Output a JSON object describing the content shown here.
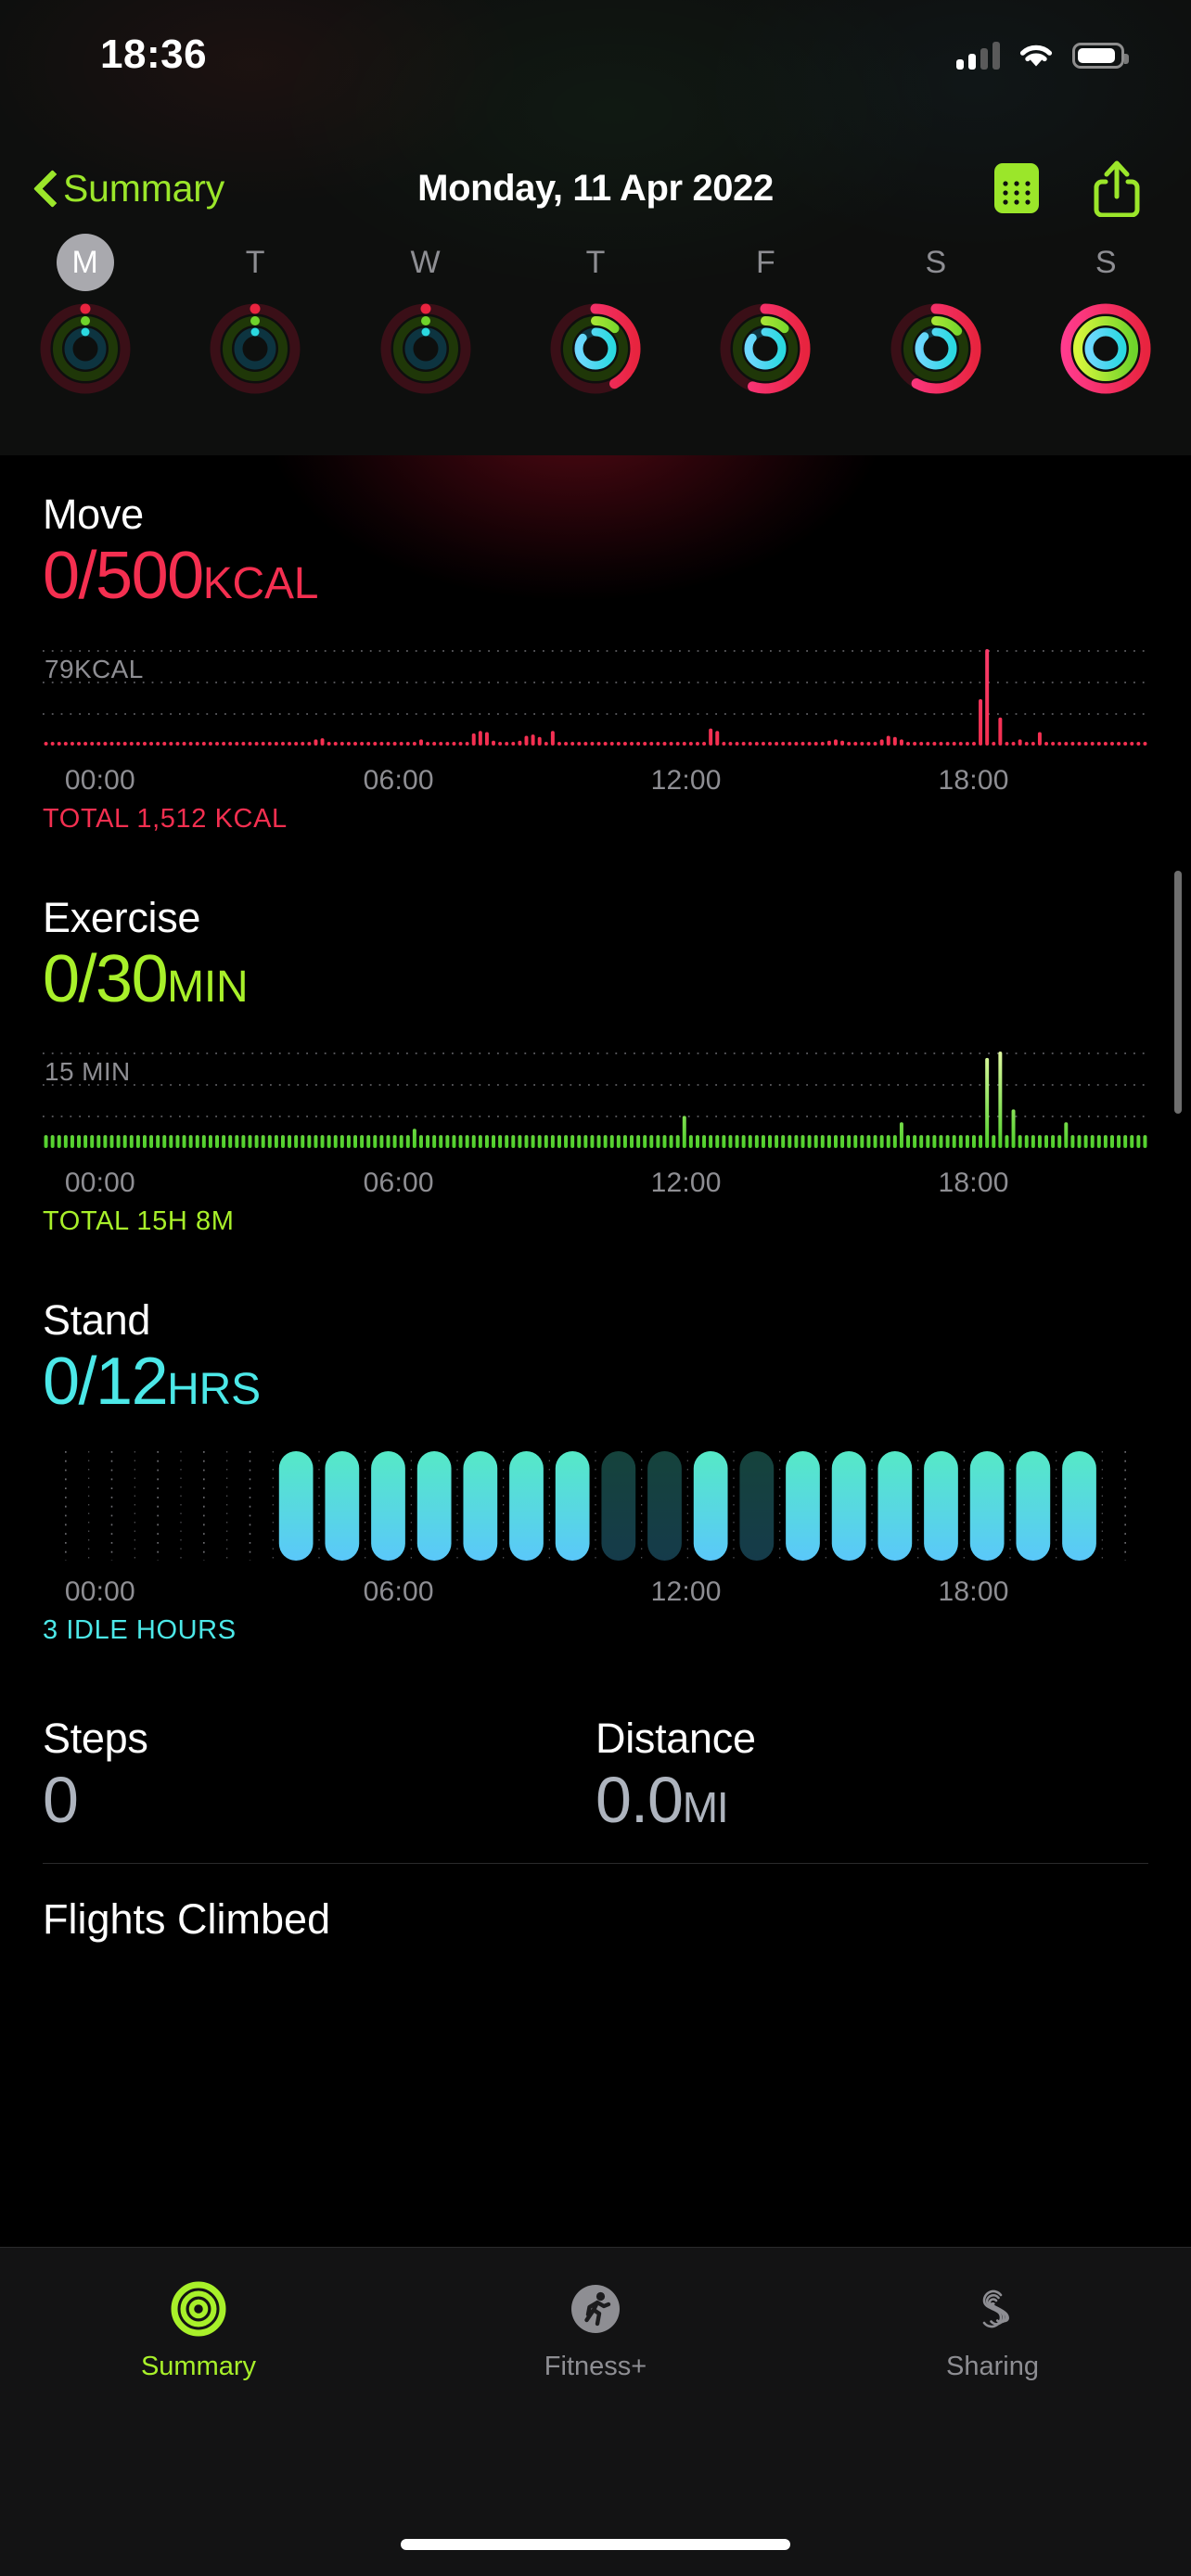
{
  "status_bar": {
    "time": "18:36",
    "cellular_icon": "cellular-signal-icon",
    "cellular_bars_filled": 2,
    "wifi_icon": "wifi-icon",
    "battery_icon": "battery-icon",
    "battery_level_pct": 78
  },
  "nav": {
    "back_label": "Summary",
    "back_icon": "chevron-left-icon",
    "title": "Monday, 11 Apr 2022",
    "calendar_icon": "calendar-icon",
    "share_icon": "share-icon"
  },
  "week": {
    "days": [
      {
        "label": "M",
        "selected": true,
        "move_pct": 0.0,
        "exercise_pct": 0.0,
        "stand_pct": 0.0
      },
      {
        "label": "T",
        "selected": false,
        "move_pct": 0.0,
        "exercise_pct": 0.0,
        "stand_pct": 0.0
      },
      {
        "label": "W",
        "selected": false,
        "move_pct": 0.0,
        "exercise_pct": 0.0,
        "stand_pct": 0.0
      },
      {
        "label": "T",
        "selected": false,
        "move_pct": 0.42,
        "exercise_pct": 0.12,
        "stand_pct": 0.86
      },
      {
        "label": "F",
        "selected": false,
        "move_pct": 0.55,
        "exercise_pct": 0.12,
        "stand_pct": 0.86
      },
      {
        "label": "S",
        "selected": false,
        "move_pct": 0.58,
        "exercise_pct": 0.14,
        "stand_pct": 0.88
      },
      {
        "label": "S",
        "selected": false,
        "move_pct": 1.0,
        "exercise_pct": 1.0,
        "stand_pct": 1.0
      }
    ]
  },
  "colors": {
    "move": "#F42F50",
    "move_top": "#FA3C6B",
    "exercise": "#A8F02A",
    "exercise_top": "#DFF9A0",
    "stand": "#4CE8E8",
    "stand_bottom": "#5AC8FA",
    "accent_green": "#9BE62A",
    "gray_text": "#8E8E93",
    "background": "#000000"
  },
  "rings": {
    "move_track": "#3a0f17",
    "exercise_track": "#1f3708",
    "stand_track": "#0d3440"
  },
  "move": {
    "title": "Move",
    "value": "0/500",
    "unit": "KCAL",
    "axis_max_label": "79KCAL",
    "total": "TOTAL 1,512 KCAL",
    "chart_data": {
      "type": "bar",
      "title": "Move",
      "ylabel": "KCAL",
      "xlabel": "",
      "ylim": [
        0,
        79
      ],
      "grid": true,
      "categories": [
        "00:00",
        "06:00",
        "12:00",
        "18:00"
      ],
      "tick_positions_pct": [
        2,
        29,
        55,
        81
      ],
      "color": "#F42F50",
      "values": [
        2,
        2,
        2,
        2,
        2,
        2,
        2,
        2,
        2,
        2,
        2,
        2,
        2,
        2,
        2,
        2,
        2,
        2,
        2,
        2,
        2,
        2,
        2,
        2,
        2,
        2,
        2,
        2,
        2,
        2,
        2,
        2,
        2,
        2,
        3,
        2,
        2,
        2,
        2,
        2,
        2,
        5,
        6,
        2,
        2,
        2,
        2,
        2,
        3,
        2,
        2,
        2,
        2,
        3,
        2,
        2,
        2,
        5,
        2,
        2,
        2,
        2,
        3,
        2,
        2,
        10,
        12,
        11,
        4,
        2,
        2,
        2,
        4,
        8,
        9,
        7,
        3,
        12,
        2,
        2,
        2,
        2,
        2,
        2,
        2,
        2,
        2,
        2,
        2,
        2,
        2,
        2,
        2,
        2,
        2,
        2,
        2,
        2,
        2,
        2,
        2,
        14,
        12,
        2,
        2,
        2,
        2,
        2,
        2,
        2,
        2,
        2,
        2,
        2,
        2,
        2,
        2,
        2,
        2,
        4,
        5,
        4,
        2,
        2,
        2,
        2,
        3,
        5,
        8,
        7,
        5,
        2,
        2,
        2,
        2,
        2,
        2,
        2,
        2,
        3,
        3,
        2,
        38,
        79,
        2,
        23,
        2,
        2,
        5,
        2,
        2,
        11,
        2,
        2,
        2,
        2,
        2,
        2,
        2,
        2,
        2,
        2,
        2,
        2,
        2,
        2,
        2,
        2
      ]
    }
  },
  "exercise": {
    "title": "Exercise",
    "value": "0/30",
    "unit": "MIN",
    "axis_max_label": "15 MIN",
    "total": "TOTAL 15H 8M",
    "chart_data": {
      "type": "bar",
      "title": "Exercise",
      "ylabel": "MIN",
      "xlabel": "",
      "ylim": [
        0,
        15
      ],
      "grid": true,
      "categories": [
        "00:00",
        "06:00",
        "12:00",
        "18:00"
      ],
      "tick_positions_pct": [
        2,
        29,
        55,
        81
      ],
      "color": "#A8F02A",
      "values": [
        2,
        2,
        2,
        2,
        2,
        2,
        2,
        2,
        2,
        2,
        2,
        2,
        2,
        2,
        2,
        2,
        2,
        2,
        2,
        2,
        2,
        2,
        2,
        2,
        2,
        2,
        2,
        2,
        2,
        2,
        2,
        2,
        2,
        2,
        2,
        2,
        2,
        2,
        2,
        2,
        2,
        2,
        2,
        2,
        2,
        2,
        2,
        2,
        2,
        2,
        2,
        2,
        2,
        2,
        2,
        2,
        3,
        2,
        2,
        2,
        2,
        2,
        2,
        2,
        2,
        2,
        2,
        2,
        2,
        2,
        2,
        2,
        2,
        2,
        2,
        2,
        2,
        2,
        2,
        2,
        2,
        2,
        2,
        2,
        2,
        2,
        2,
        2,
        2,
        2,
        2,
        2,
        2,
        2,
        2,
        2,
        2,
        5,
        2,
        2,
        2,
        2,
        2,
        2,
        2,
        2,
        2,
        2,
        2,
        2,
        2,
        2,
        2,
        2,
        2,
        2,
        2,
        2,
        2,
        2,
        2,
        2,
        2,
        2,
        2,
        2,
        2,
        2,
        2,
        2,
        4,
        2,
        2,
        2,
        2,
        2,
        2,
        2,
        2,
        2,
        2,
        2,
        2,
        4,
        2,
        2,
        2,
        2,
        2,
        2,
        2,
        2,
        2,
        2,
        2,
        2,
        2,
        2,
        2,
        2,
        2,
        2,
        2,
        2,
        2,
        2,
        2,
        2
      ],
      "tall_bars": [
        {
          "index": 143,
          "value": 14
        },
        {
          "index": 145,
          "value": 15
        },
        {
          "index": 147,
          "value": 6
        },
        {
          "index": 155,
          "value": 4
        }
      ]
    }
  },
  "stand": {
    "title": "Stand",
    "value": "0/12",
    "unit": "HRS",
    "total": "3 IDLE HOURS",
    "chart_data": {
      "type": "bar",
      "title": "Stand",
      "ylabel": "HRS",
      "xlabel": "",
      "grid": true,
      "categories": [
        "00:00",
        "06:00",
        "12:00",
        "18:00"
      ],
      "tick_positions_pct": [
        2,
        29,
        55,
        81
      ],
      "color": "#4CE8E8",
      "hours": [
        {
          "hour": 0,
          "state": "none"
        },
        {
          "hour": 1,
          "state": "none"
        },
        {
          "hour": 2,
          "state": "none"
        },
        {
          "hour": 3,
          "state": "none"
        },
        {
          "hour": 4,
          "state": "none"
        },
        {
          "hour": 5,
          "state": "stood"
        },
        {
          "hour": 6,
          "state": "stood"
        },
        {
          "hour": 7,
          "state": "stood"
        },
        {
          "hour": 8,
          "state": "stood"
        },
        {
          "hour": 9,
          "state": "stood"
        },
        {
          "hour": 10,
          "state": "stood"
        },
        {
          "hour": 11,
          "state": "stood"
        },
        {
          "hour": 12,
          "state": "idle"
        },
        {
          "hour": 13,
          "state": "idle"
        },
        {
          "hour": 14,
          "state": "stood"
        },
        {
          "hour": 15,
          "state": "idle"
        },
        {
          "hour": 16,
          "state": "stood"
        },
        {
          "hour": 17,
          "state": "stood"
        },
        {
          "hour": 18,
          "state": "stood"
        },
        {
          "hour": 19,
          "state": "stood"
        },
        {
          "hour": 20,
          "state": "stood"
        },
        {
          "hour": 21,
          "state": "stood"
        },
        {
          "hour": 22,
          "state": "stood"
        },
        {
          "hour": 23,
          "state": "none"
        }
      ]
    }
  },
  "steps": {
    "title": "Steps",
    "value": "0",
    "unit": ""
  },
  "distance": {
    "title": "Distance",
    "value": "0.0",
    "unit": "MI"
  },
  "flights": {
    "title": "Flights Climbed"
  },
  "tabs": [
    {
      "label": "Summary",
      "icon": "activity-rings-icon",
      "active": true
    },
    {
      "label": "Fitness+",
      "icon": "running-person-icon",
      "active": false
    },
    {
      "label": "Sharing",
      "icon": "sharing-s-icon",
      "active": false
    }
  ]
}
